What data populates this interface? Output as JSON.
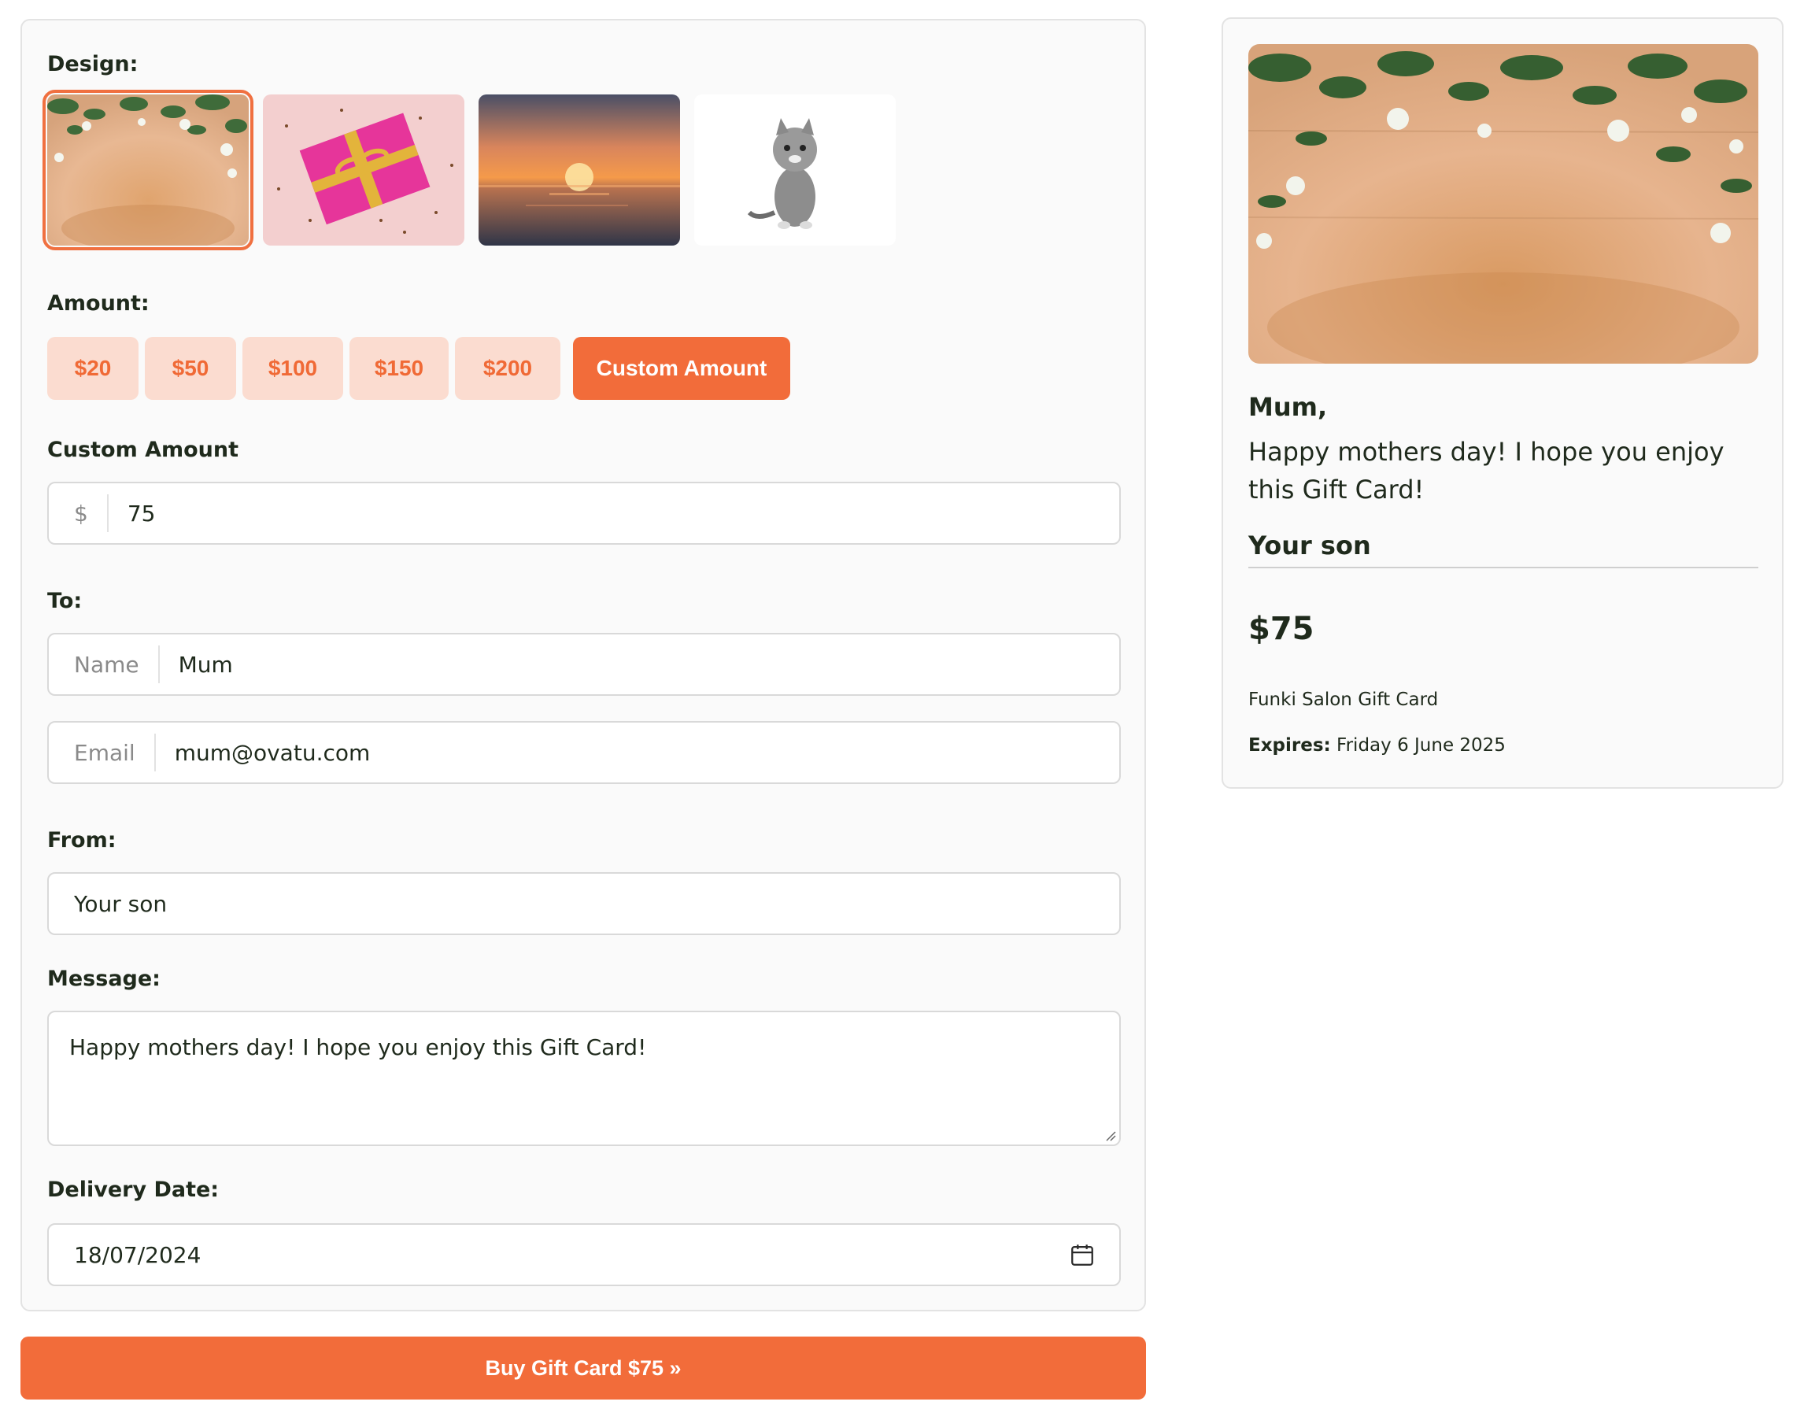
{
  "form": {
    "design_label": "Design:",
    "designs": [
      {
        "name": "Flowers on wood",
        "selected": true
      },
      {
        "name": "Pink gift box",
        "selected": false
      },
      {
        "name": "Sunset over sea",
        "selected": false
      },
      {
        "name": "Kitten",
        "selected": false
      }
    ],
    "amount_label": "Amount:",
    "amounts": [
      "$20",
      "$50",
      "$100",
      "$150",
      "$200"
    ],
    "custom_amount_button": "Custom Amount",
    "custom_amount_label": "Custom Amount",
    "custom_amount_prefix": "$",
    "custom_amount_value": "75",
    "to_label": "To:",
    "to_name_prefix": "Name",
    "to_name_value": "Mum",
    "to_email_prefix": "Email",
    "to_email_value": "mum@ovatu.com",
    "from_label": "From:",
    "from_value": "Your son",
    "message_label": "Message:",
    "message_value": "Happy mothers day! I hope you enjoy this Gift Card!",
    "delivery_label": "Delivery Date:",
    "delivery_value": "18/07/2024",
    "buy_button": "Buy Gift Card $75 »"
  },
  "preview": {
    "to": "Mum,",
    "message": "Happy mothers day! I hope you enjoy this Gift Card!",
    "from": "Your son",
    "amount": "$75",
    "card_name": "Funki Salon Gift Card",
    "expires_label": "Expires:",
    "expires_value": "Friday 6 June 2025"
  },
  "colors": {
    "accent": "#f26c3a",
    "accent_light": "#fbdcd0",
    "text": "#1f2a1c"
  },
  "icons": {
    "calendar": "calendar-icon"
  }
}
